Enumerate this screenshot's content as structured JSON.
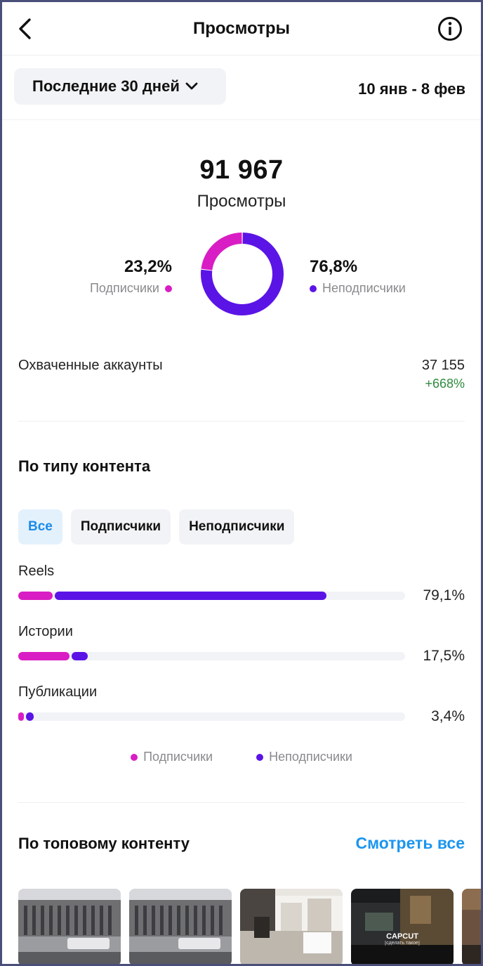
{
  "header": {
    "title": "Просмотры"
  },
  "period": {
    "selector_label": "Последние 30 дней",
    "date_range": "10 янв - 8 фев"
  },
  "summary": {
    "total_views": "91 967",
    "views_label": "Просмотры",
    "followers_pct": "23,2%",
    "followers_label": "Подписчики",
    "non_followers_pct": "76,8%",
    "non_followers_label": "Неподписчики",
    "followers_share": 0.232,
    "non_followers_share": 0.768
  },
  "reach": {
    "label": "Охваченные аккаунты",
    "value": "37 155",
    "delta": "+668%"
  },
  "content_type": {
    "title": "По типу контента",
    "filters": [
      "Все",
      "Подписчики",
      "Неподписчики"
    ],
    "active_filter": 0,
    "rows": [
      {
        "label": "Reels",
        "percent": "79,1%",
        "followers": 0.089,
        "non_followers": 0.702
      },
      {
        "label": "Истории",
        "percent": "17,5%",
        "followers": 0.132,
        "non_followers": 0.043
      },
      {
        "label": "Публикации",
        "percent": "3,4%",
        "followers": 0.015,
        "non_followers": 0.019
      }
    ],
    "legend": {
      "followers": "Подписчики",
      "non_followers": "Неподписчики"
    }
  },
  "top_content": {
    "title": "По топовому контенту",
    "see_all": "Смотреть все",
    "thumbnails": [
      {
        "kind": "building"
      },
      {
        "kind": "building"
      },
      {
        "kind": "room"
      },
      {
        "kind": "car",
        "overlay_title": "CAPCUT",
        "overlay_sub": "[сделать такое]"
      },
      {
        "kind": "partial"
      }
    ]
  },
  "colors": {
    "followers": "#d91dc4",
    "non_followers": "#5b14e6",
    "link": "#1b95f0",
    "positive": "#2e8b3e"
  }
}
